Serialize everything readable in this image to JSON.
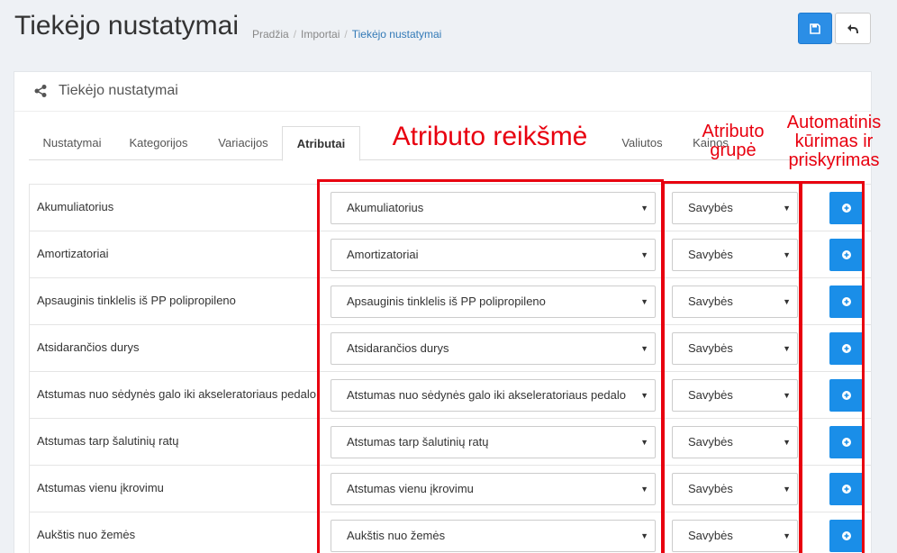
{
  "header": {
    "title": "Tiekėjo nustatymai",
    "breadcrumb": [
      "Pradžia",
      "Importai",
      "Tiekėjo nustatymai"
    ],
    "save_icon": "floppy-icon",
    "back_icon": "undo-arrow-icon"
  },
  "portlet": {
    "title": "Tiekėjo nustatymai",
    "icon": "share-icon"
  },
  "tabs": [
    "Nustatymai",
    "Kategorijos",
    "Variacijos",
    "Atributai",
    "Valiutos",
    "Kainos"
  ],
  "active_tab": "Atributai",
  "annotations": {
    "col_value": "Atributo reikšmė",
    "col_group_line1": "Atributo",
    "col_group_line2": "grupė",
    "col_auto_line1": "Automatinis",
    "col_auto_line2": "kūrimas ir",
    "col_auto_line3": "priskyrimas",
    "highlight_color": "#e8000f"
  },
  "rows": [
    {
      "label": "Akumuliatorius",
      "value": "Akumuliatorius",
      "group": "Savybės"
    },
    {
      "label": "Amortizatoriai",
      "value": "Amortizatoriai",
      "group": "Savybės"
    },
    {
      "label": "Apsauginis tinklelis iš PP polipropileno",
      "value": "Apsauginis tinklelis iš PP polipropileno",
      "group": "Savybės"
    },
    {
      "label": "Atsidarančios durys",
      "value": "Atsidarančios durys",
      "group": "Savybės"
    },
    {
      "label": "Atstumas nuo sėdynės galo iki akseleratoriaus pedalo",
      "value": "Atstumas nuo sėdynės galo iki akseleratoriaus pedalo",
      "group": "Savybės"
    },
    {
      "label": "Atstumas tarp šalutinių ratų",
      "value": "Atstumas tarp šalutinių ratų",
      "group": "Savybės"
    },
    {
      "label": "Atstumas vienu įkrovimu",
      "value": "Atstumas vienu įkrovimu",
      "group": "Savybės"
    },
    {
      "label": "Aukštis nuo žemės",
      "value": "Aukštis nuo žemės",
      "group": "Savybės"
    }
  ],
  "colors": {
    "primary": "#1a8ee8",
    "accent_red": "#e8000f"
  }
}
